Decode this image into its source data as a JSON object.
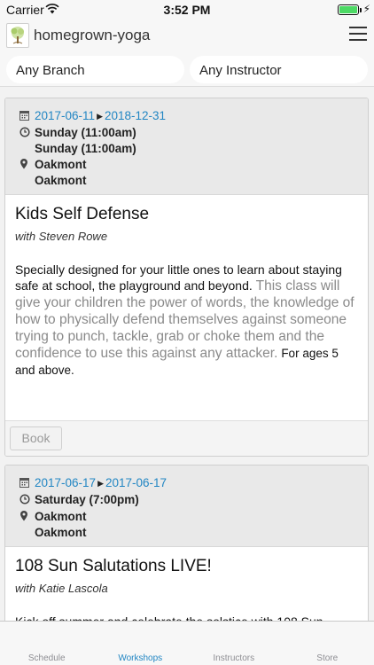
{
  "status_bar": {
    "carrier": "Carrier",
    "time": "3:52 PM",
    "battery_level": 1.0
  },
  "header": {
    "title": "homegrown-yoga",
    "logo_icon": "tree-logo-icon",
    "menu_icon": "hamburger-menu-icon"
  },
  "filters": {
    "branch": "Any Branch",
    "instructor": "Any Instructor"
  },
  "workshops": [
    {
      "start_date": "2017-06-11",
      "end_date": "2018-12-31",
      "times": [
        "Sunday (11:00am)",
        "Sunday (11:00am)"
      ],
      "locations": [
        "Oakmont",
        "Oakmont"
      ],
      "title": "Kids Self Defense",
      "instructor": "with Steven Rowe",
      "desc_part1": "Specially designed for your little ones to learn about staying safe at school, the playground and beyond.",
      "desc_part2": "This class will give your children the power of words, the knowledge of how to physically defend themselves against someone trying to punch, tackle, grab or choke them and the confidence to use this against any attacker.",
      "desc_part3": "For ages 5 and above.",
      "book_label": "Book"
    },
    {
      "start_date": "2017-06-17",
      "end_date": "2017-06-17",
      "times": [
        "Saturday (7:00pm)"
      ],
      "locations": [
        "Oakmont",
        "Oakmont"
      ],
      "title": "108 Sun Salutations LIVE!",
      "instructor": "with Katie Lascola",
      "desc_part1": "Kick off summer and celebrate the solstice with 108 Sun"
    }
  ],
  "tabs": [
    {
      "label": "Schedule",
      "active": false
    },
    {
      "label": "Workshops",
      "active": true
    },
    {
      "label": "Instructors",
      "active": false
    },
    {
      "label": "Store",
      "active": false
    }
  ],
  "colors": {
    "accent": "#2286c3",
    "battery": "#4cd964"
  }
}
